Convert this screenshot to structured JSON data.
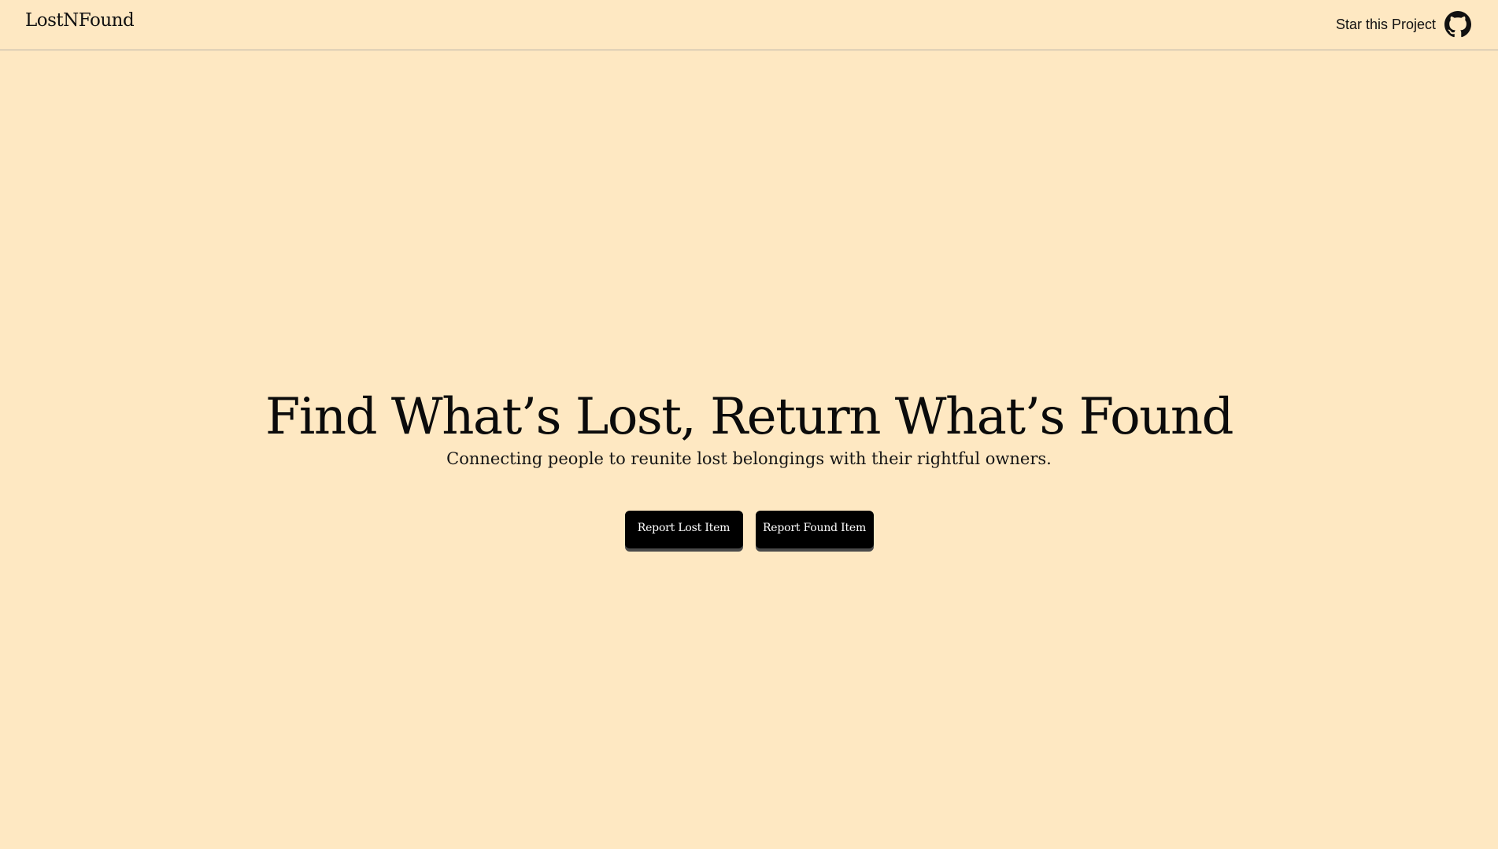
{
  "navbar": {
    "brand": "LostNFound",
    "star_label": "Star this Project",
    "star_icon": "github-icon"
  },
  "hero": {
    "title": "Find What’s Lost, Return What’s Found",
    "subtitle": "Connecting people to reunite lost belongings with their rightful owners."
  },
  "actions": {
    "report_lost_label": "Report Lost Item",
    "report_found_label": "Report Found Item"
  },
  "colors": {
    "background": "#fee8c2",
    "text": "#0b0b0b",
    "button": "#000000",
    "button_text": "#ffffff"
  }
}
